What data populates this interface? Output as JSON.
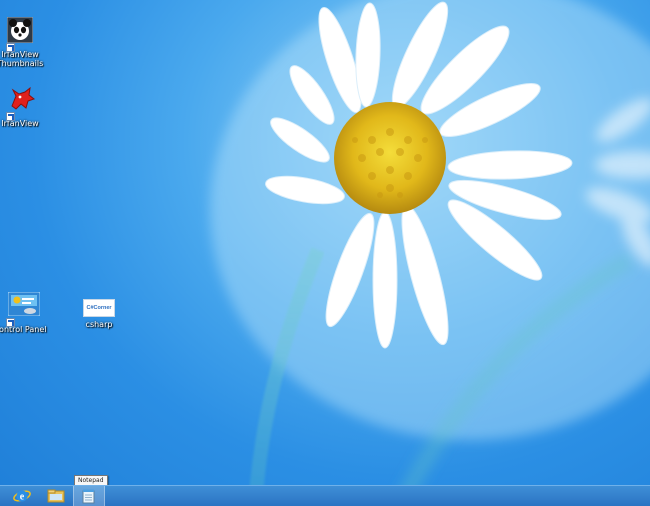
{
  "desktop": {
    "icons": [
      {
        "label": "IrfanView Thumbnails"
      },
      {
        "label": "IrfanView"
      },
      {
        "label": "Control Panel"
      },
      {
        "label": "csharp",
        "logo_text": "C#Corner"
      }
    ]
  },
  "taskbar": {
    "buttons": [
      {
        "name": "Internet Explorer",
        "icon": "internet-explorer-icon"
      },
      {
        "name": "File Explorer",
        "icon": "folder-icon"
      },
      {
        "name": "Notepad",
        "icon": "notepad-icon",
        "active": true
      }
    ],
    "tooltip": "Notepad"
  },
  "colors": {
    "taskbar": "#2f7ccb",
    "sky": "#2b8fe4",
    "petal": "#ffffff",
    "flower_center": "#e8c21a"
  }
}
